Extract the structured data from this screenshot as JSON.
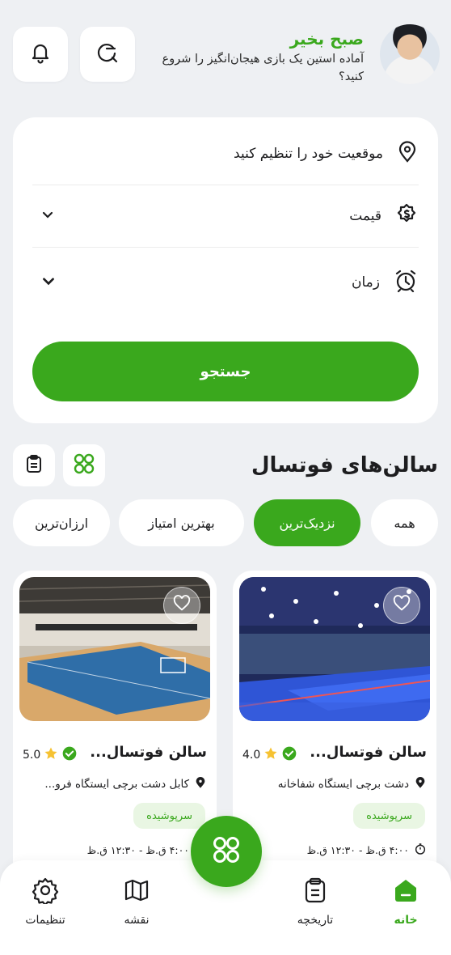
{
  "header": {
    "greeting": "صبح بخیر",
    "subtitle": "آماده استین یک بازی هیجان‌انگیز را شروع کنید؟"
  },
  "filters": {
    "location": "موقعیت خود را تنظیم کنید",
    "price": "قیمت",
    "time": "زمان",
    "search_button": "جستجو"
  },
  "section": {
    "title": "سالن‌های فوتسال"
  },
  "chips": [
    {
      "label": "همه",
      "active": false
    },
    {
      "label": "نزدیک‌ترین",
      "active": true
    },
    {
      "label": "بهترین امتیاز",
      "active": false
    },
    {
      "label": "ارزان‌ترین",
      "active": false
    }
  ],
  "venues": [
    {
      "name": "سالن فوتسال...",
      "rating": "4.0",
      "address": "دشت برچی ایستگاه شفاخانه",
      "badge": "سرپوشیده",
      "hours": "۴:۰۰ ق.ظ - ۱۲:۳۰ ق.ظ"
    },
    {
      "name": "سالن فوتسال...",
      "rating": "5.0",
      "address": "کابل دشت برچی ایستگاه فرو...",
      "badge": "سرپوشیده",
      "hours": "۴:۰۰ ق.ظ - ۱۲:۳۰ ق.ظ"
    }
  ],
  "nav": {
    "home": "خانه",
    "history": "تاریخچه",
    "map": "نقشه",
    "settings": "تنظیمات"
  },
  "colors": {
    "accent": "#3aa81d",
    "background": "#eef0f3"
  }
}
